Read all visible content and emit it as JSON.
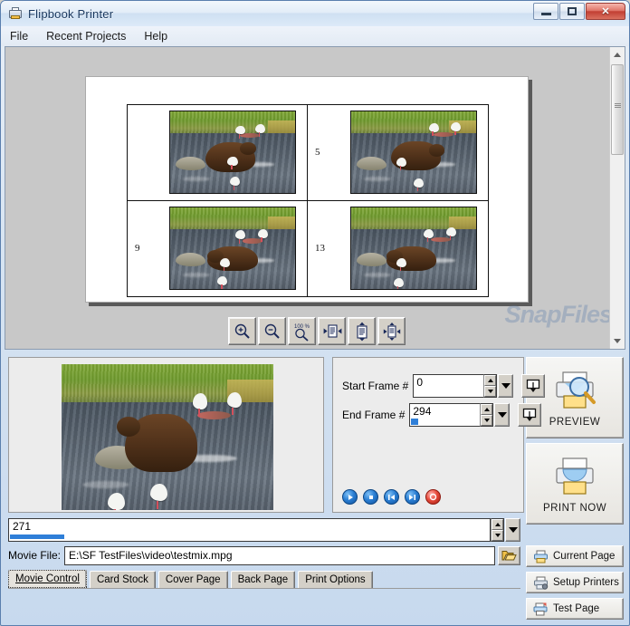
{
  "window": {
    "title": "Flipbook Printer",
    "icon": "printer-icon",
    "caption": {
      "minimize": "minimize-icon",
      "maximize": "maximize-icon",
      "close": "✕"
    }
  },
  "menubar": {
    "items": [
      {
        "label": "File"
      },
      {
        "label": "Recent Projects"
      },
      {
        "label": "Help"
      }
    ]
  },
  "preview": {
    "watermark": "SnapFiles",
    "page_frames": [
      {
        "number": ""
      },
      {
        "number": "5"
      },
      {
        "number": "9"
      },
      {
        "number": "13"
      }
    ],
    "toolbar": [
      {
        "name": "zoom-in",
        "tooltip": "Zoom In"
      },
      {
        "name": "zoom-out",
        "tooltip": "Zoom Out"
      },
      {
        "name": "zoom-100",
        "label": "100 %"
      },
      {
        "name": "fit-width",
        "tooltip": "Fit Width"
      },
      {
        "name": "fit-height",
        "tooltip": "Fit Height"
      },
      {
        "name": "fit-page",
        "tooltip": "Fit Page"
      }
    ]
  },
  "movie_control": {
    "start_frame": {
      "label": "Start Frame #",
      "value": "0"
    },
    "end_frame": {
      "label": "End Frame #",
      "value": "294"
    },
    "current_frame": "271",
    "movie_file": {
      "label": "Movie File:",
      "value": "E:\\SF TestFiles\\video\\testmix.mpg"
    },
    "transport": [
      {
        "name": "play-button",
        "glyph": "play"
      },
      {
        "name": "stop-button",
        "glyph": "stop"
      },
      {
        "name": "previous-button",
        "glyph": "prev"
      },
      {
        "name": "next-button",
        "glyph": "next"
      },
      {
        "name": "record-button",
        "glyph": "record"
      }
    ]
  },
  "tabs": [
    {
      "label": "Movie Control",
      "active": true
    },
    {
      "label": "Card Stock",
      "active": false
    },
    {
      "label": "Cover Page",
      "active": false
    },
    {
      "label": "Back Page",
      "active": false
    },
    {
      "label": "Print Options",
      "active": false
    }
  ],
  "actions": {
    "preview": "PREVIEW",
    "print_now": "PRINT NOW",
    "current_page": "Current Page",
    "setup_printers": "Setup Printers",
    "test_page": "Test Page"
  },
  "colors": {
    "accent_blue": "#2f7fd8",
    "title_text": "#17365d",
    "close_red": "#c23f33",
    "face": "#d4d0c8"
  }
}
